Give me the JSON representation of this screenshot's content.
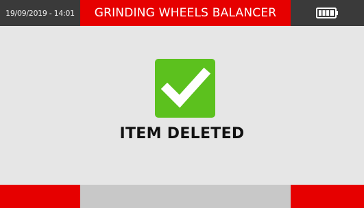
{
  "header": {
    "datetime": "19/09/2019 - 14:01",
    "title": "GRINDING WHEELS BALANCER",
    "battery_icon": "battery-full-icon"
  },
  "main": {
    "status_icon": "checkmark-icon",
    "message": "ITEM DELETED"
  },
  "footer": {
    "left_key_label": "",
    "center_key_label": "",
    "right_key_label": ""
  },
  "colors": {
    "header_red": "#e60000",
    "header_dark": "#3a3a3a",
    "background": "#e6e6e6",
    "success_green": "#5cc11e",
    "softkey_gray": "#c8c8c8"
  }
}
